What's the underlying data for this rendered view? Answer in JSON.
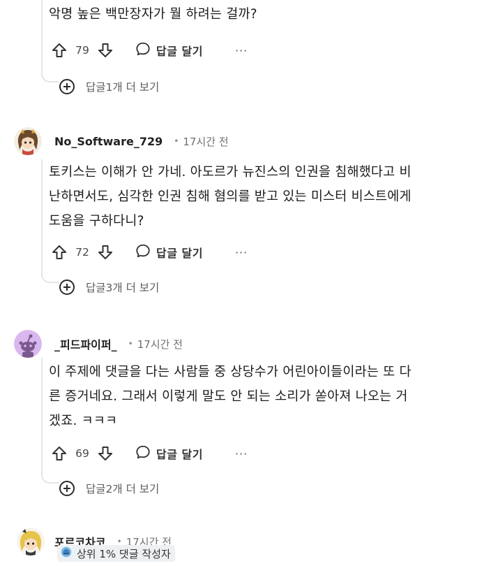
{
  "comments": [
    {
      "text_lines": [
        "악명 높은 백만장자가 뭘 하려는 걸까?"
      ],
      "votes": "79",
      "reply_label": "답글 달기",
      "more_label": "···",
      "more_replies": "답글1개 더 보기"
    },
    {
      "username": "No_Software_729",
      "dot": "•",
      "time": "17시간 전",
      "avatar_icon": "anime-girl-avatar",
      "text_lines": [
        "토키스는 이해가 안 가네. 아도르가 뉴진스의 인권을 침해했다고 비",
        "난하면서도, 심각한 인권 침해 혐의를 받고 있는 미스터 비스트에게",
        "도움을 구하다니?"
      ],
      "votes": "72",
      "reply_label": "답글 달기",
      "more_label": "···",
      "more_replies": "답글3개 더 보기"
    },
    {
      "username": "_피드파이퍼_",
      "dot": "•",
      "time": "17시간 전",
      "avatar_icon": "default-snoo-avatar",
      "text_lines": [
        "이 주제에 댓글을 다는 사람들 중 상당수가 어린아이들이라는 또 다",
        "른 증거네요. 그래서 이렇게 말도 안 되는 소리가 쏟아져 나오는 거",
        "겠죠. ㅋㅋㅋ"
      ],
      "votes": "69",
      "reply_label": "답글 달기",
      "more_label": "···",
      "more_replies": "답글2개 더 보기"
    },
    {
      "username": "포르코차코",
      "dot": "•",
      "time": "17시간 전",
      "avatar_icon": "blonde-girl-avatar",
      "flair": "상위 1% 댓글 작성자",
      "flair_icon": "top-commenter-icon"
    }
  ]
}
